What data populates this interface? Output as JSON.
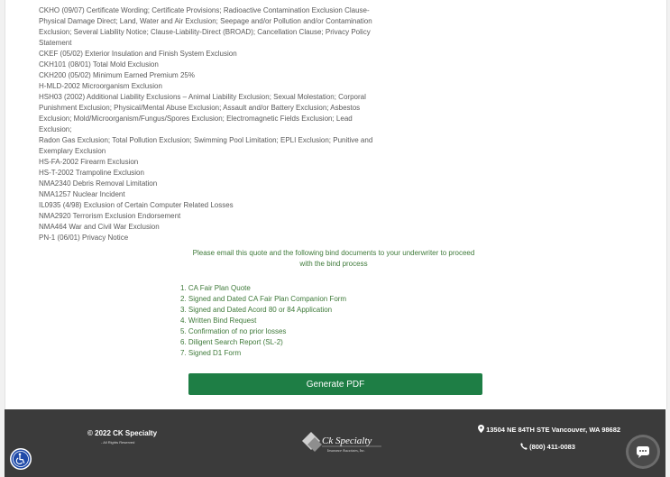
{
  "forms": [
    "CKHO (09/07) Certificate Wording; Certificate Provisions; Radioactive Contamination Exclusion Clause-",
    "Physical Damage Direct; Land, Water and Air Exclusion; Seepage and/or Pollution and/or Contamination",
    "Exclusion; Several Liability Notice; Clause-Liability-Direct (BROAD); Cancellation Clause; Privacy Policy Statement",
    "CKEF (05/02) Exterior Insulation and Finish System Exclusion",
    "CKH101 (08/01) Total Mold Exclusion",
    "CKH200 (05/02) Minimum Earned Premium 25%",
    "H-MLD-2002 Microorganism Exclusion",
    "HSH03 (2002) Additional Liability Exclusions – Animal Liability Exclusion; Sexual Molestation; Corporal",
    "Punishment Exclusion; Physical/Mental Abuse Exclusion; Assault and/or Battery Exclusion; Asbestos",
    "Exclusion; Mold/Microorganism/Fungus/Spores Exclusion; Electromagnetic Fields Exclusion; Lead",
    "Exclusion;",
    "Radon Gas Exclusion; Total Pollution Exclusion; Swimming Pool Limitation; EPLI Exclusion; Punitive and",
    "Exemplary Exclusion",
    "HS-FA-2002 Firearm Exclusion",
    "HS-T-2002 Trampoline Exclusion",
    "NMA2340 Debris Removal Limitation",
    "NMA1257 Nuclear Incident",
    "IL0935 (4/98) Exclusion of Certain Computer Related Losses",
    "NMA2920 Terrorism Exclusion Endorsement",
    "NMA464 War and Civil War Exclusion",
    "PN-1 (06/01) Privacy Notice"
  ],
  "notice": {
    "line1": "Please email this quote and the following bind documents to your underwriter to proceed",
    "line2": "with the bind process"
  },
  "bind_documents": [
    "1. CA Fair Plan Quote",
    "2. Signed and Dated CA Fair Plan Companion Form",
    "3. Signed and Dated Acord 80 or 84 Application",
    "4. Written Bind Request",
    "5. Confirmation of no prior losses",
    "6. Diligent Search Report (SL-2)",
    "7. Signed D1 Form"
  ],
  "generate_pdf_label": "Generate PDF",
  "footer": {
    "copyright": "© 2022 CK Specialty",
    "rights": "- All Rights Reserved",
    "logo_name": "Ck Specialty",
    "logo_tagline": "Insurance Associates, Inc.",
    "address": "13504 NE 84TH STE Vancouver, WA 98682",
    "phone": "(800) 411-0083"
  },
  "icons": {
    "address": "map-marker-icon",
    "phone": "phone-icon",
    "accessibility": "accessibility-icon",
    "chat": "chat-icon"
  },
  "colors": {
    "accent_green": "#1e7e45",
    "text_green": "#3f7a3a",
    "footer_bg": "#3b3b3b",
    "accessibility_blue": "#1f4aa8"
  }
}
